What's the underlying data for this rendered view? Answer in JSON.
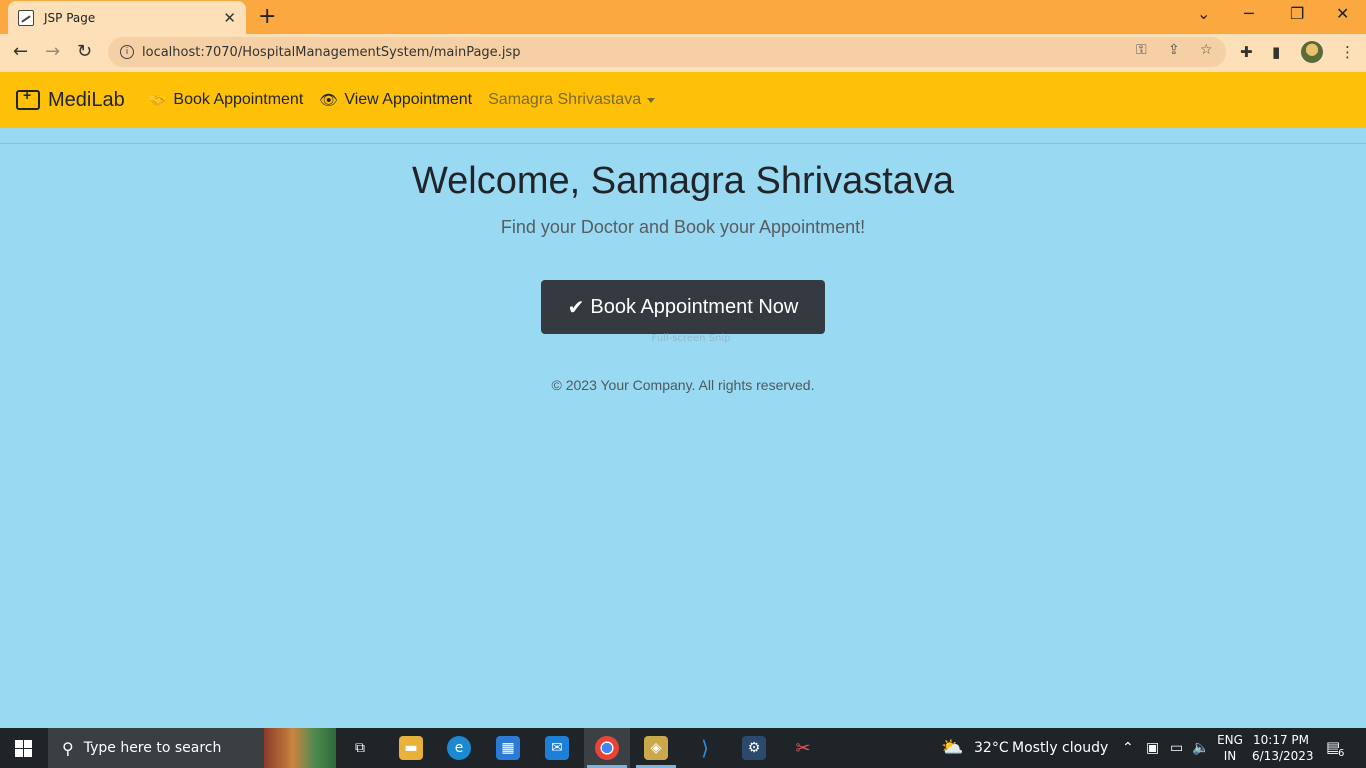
{
  "browser": {
    "tab_title": "JSP Page",
    "url": "localhost:7070/HospitalManagementSystem/mainPage.jsp"
  },
  "site": {
    "brand": "MediLab",
    "nav": {
      "book": "Book Appointment",
      "view": "View Appointment",
      "user": "Samagra Shrivastava"
    }
  },
  "hero": {
    "title": "Welcome, Samagra Shrivastava",
    "subtitle": "Find your Doctor and Book your Appointment!",
    "cta": "Book Appointment Now",
    "snip_label": "Full-screen Snip"
  },
  "footer": "© 2023 Your Company. All rights reserved.",
  "taskbar": {
    "search_placeholder": "Type here to search",
    "weather_temp": "32°C",
    "weather_text": "Mostly cloudy",
    "lang_1": "ENG",
    "lang_2": "IN",
    "time": "10:17 PM",
    "date": "6/13/2023",
    "notifications": "6"
  },
  "colors": {
    "navbar": "#ffc107",
    "page_bg": "#9ad9f2",
    "cta_bg": "#343a40",
    "tabstrip": "#fba841"
  }
}
